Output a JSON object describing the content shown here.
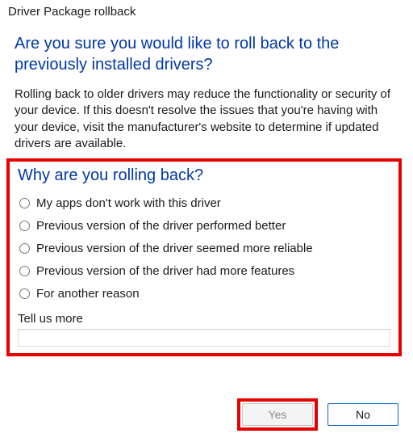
{
  "window": {
    "title": "Driver Package rollback"
  },
  "heading": "Are you sure you would like to roll back to the previously installed drivers?",
  "body": "Rolling back to older drivers may reduce the functionality or security of your device. If this doesn't resolve the issues that you're having with your device, visit the manufacturer's website to determine if updated drivers are available.",
  "subheading": "Why are you rolling back?",
  "reasons": [
    "My apps don't work with this driver",
    "Previous version of the driver performed better",
    "Previous version of the driver seemed more reliable",
    "Previous version of the driver had more features",
    "For another reason"
  ],
  "tell_more_label": "Tell us more",
  "tell_more_value": "",
  "buttons": {
    "yes": "Yes",
    "no": "No"
  },
  "highlight_color": "#e60000",
  "accent_color": "#0037a6"
}
